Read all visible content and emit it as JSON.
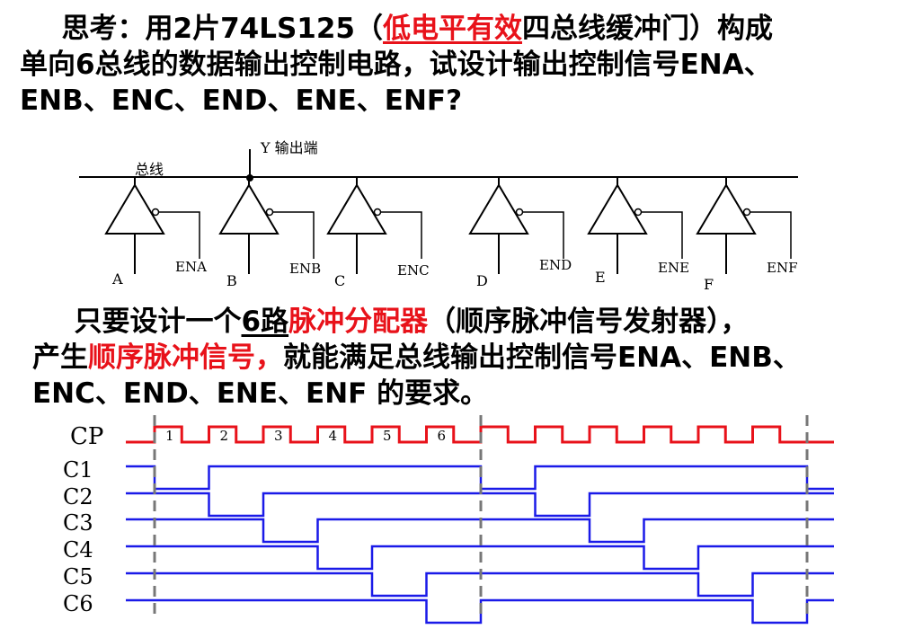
{
  "question": {
    "prefix": "思考：用2片74LS125（",
    "highlight": "低电平有效",
    "suffix_line1": "四总线缓冲门）构成",
    "line2": "单向6总线的数据输出控制电路，试设计输出控制信号ENA、",
    "line3": "ENB、ENC、END、ENE、ENF?"
  },
  "circuit": {
    "output_label": "Y 输出端",
    "bus_label": "总线",
    "inputs": [
      "A",
      "B",
      "C",
      "D",
      "E",
      "F"
    ],
    "enables": [
      "ENA",
      "ENB",
      "ENC",
      "END",
      "ENE",
      "ENF"
    ]
  },
  "answer": {
    "part1": "只要设计一个",
    "part2": "6路",
    "part3": "脉冲分配器",
    "part4": "（顺序脉冲信号发射器），",
    "part5": "产生",
    "part6": "顺序脉冲信号，",
    "part7": "就能满足总线输出控制信号ENA、ENB、",
    "line3": "ENC、END、ENE、ENF 的要求。"
  },
  "timing": {
    "cp_label": "CP",
    "pulse_numbers": [
      "1",
      "2",
      "3",
      "4",
      "5",
      "6"
    ],
    "signals": [
      "C1",
      "C2",
      "C3",
      "C4",
      "C5",
      "C6"
    ],
    "cp_color": "#e8121a",
    "signal_color": "#1a1ae8",
    "active_level": "low",
    "active_pulse_index": [
      1,
      2,
      3,
      4,
      5,
      6
    ]
  }
}
